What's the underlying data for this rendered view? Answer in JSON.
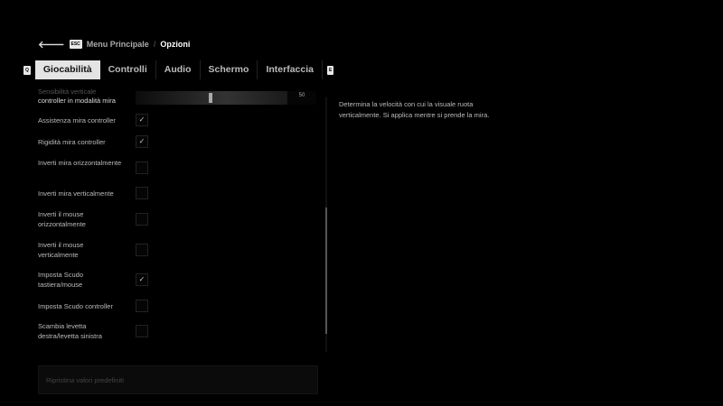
{
  "breadcrumb": {
    "back_key": "ESC",
    "parent": "Menu Principale",
    "separator": "/",
    "current": "Opzioni"
  },
  "tabs": {
    "prev_key": "Q",
    "next_key": "E",
    "items": [
      {
        "label": "Giocabilità",
        "active": true
      },
      {
        "label": "Controlli"
      },
      {
        "label": "Audio"
      },
      {
        "label": "Schermo"
      },
      {
        "label": "Interfaccia"
      }
    ]
  },
  "settings": {
    "slider": {
      "label_top": "Sensibilità verticale",
      "label": "controller in modalità mira",
      "value": "50"
    },
    "items": [
      {
        "label": "Assistenza mira controller",
        "checked": true
      },
      {
        "label": "Rigidità mira controller",
        "checked": true
      },
      {
        "label": "Inverti mira orizzontalmente",
        "checked": false
      },
      {
        "label": "Inverti mira verticalmente",
        "checked": false
      },
      {
        "label": "Inverti il mouse orizzontalmente",
        "checked": false
      },
      {
        "label": "Inverti il mouse verticalmente",
        "checked": false
      },
      {
        "label": "Imposta Scudo tastiera/mouse",
        "checked": true
      },
      {
        "label": "Imposta Scudo controller",
        "checked": false
      },
      {
        "label": "Scambia levetta destra/levetta sinistra",
        "checked": false
      }
    ]
  },
  "reset_label": "Ripristina valori predefiniti",
  "description": "Determina la velocità con cui la visuale ruota verticalmente. Si applica mentre si prende la mira.",
  "check_glyph": "✓"
}
